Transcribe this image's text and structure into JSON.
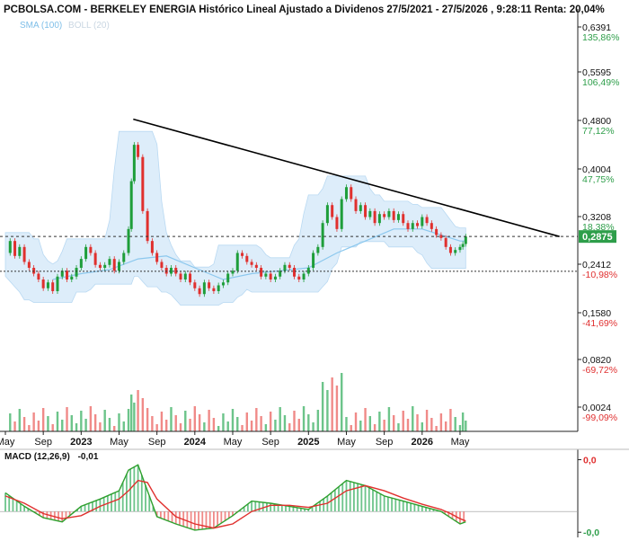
{
  "title": "PCBOLSA.COM - BERKELEY ENERGIA Histórico Lineal Ajustado a Dividenos 27/5/2021 - 27/5/2026 , 9:28:11 Renta: 20,04%",
  "indicators": {
    "sma": "SMA (100)",
    "boll": "BOLL (20)"
  },
  "colors": {
    "up": "#1e9e3a",
    "down": "#e0302e",
    "sma": "#8cc8ee",
    "boll_band": "#cfe6f8",
    "volume_up": "#6cc48a",
    "volume_down": "#f08a88",
    "trendline": "#000000",
    "current_price_box": "#2e9e4a",
    "positive_pct": "#2e9e4a",
    "negative_pct": "#e03030",
    "macd_fast": "#2ea02e",
    "macd_signal": "#e0302e"
  },
  "chart_data": [
    {
      "type": "line",
      "name": "price",
      "y_ticks": [
        {
          "price": "0,6391",
          "pct": "135,86%",
          "value": 0.6391,
          "sign": "pos"
        },
        {
          "price": "0,5595",
          "pct": "106,49%",
          "value": 0.5595,
          "sign": "pos"
        },
        {
          "price": "0,4800",
          "pct": "77,12%",
          "value": 0.48,
          "sign": "pos"
        },
        {
          "price": "0,4004",
          "pct": "47,75%",
          "value": 0.4004,
          "sign": "pos"
        },
        {
          "price": "0,3208",
          "pct": "18,38%",
          "value": 0.3208,
          "sign": "pos"
        },
        {
          "price": "0,2412",
          "pct": "-10,98%",
          "value": 0.2412,
          "sign": "neg"
        },
        {
          "price": "0,1580",
          "pct": "-41,69%",
          "value": 0.158,
          "sign": "neg"
        },
        {
          "price": "0,0820",
          "pct": "-69,72%",
          "value": 0.082,
          "sign": "neg"
        },
        {
          "price": "0,0024",
          "pct": "-99,09%",
          "value": 0.0024,
          "sign": "neg"
        }
      ],
      "ylim": [
        0.0,
        0.6391
      ],
      "current_price": {
        "label": "0,2875",
        "value": 0.2875
      },
      "reference_price": 0.229,
      "x_ticks": [
        {
          "label": "May",
          "t": 0.0,
          "bold": false
        },
        {
          "label": "Sep",
          "t": 4.0,
          "bold": false
        },
        {
          "label": "2023",
          "t": 8.0,
          "bold": true
        },
        {
          "label": "May",
          "t": 12.0,
          "bold": false
        },
        {
          "label": "Sep",
          "t": 16.0,
          "bold": false
        },
        {
          "label": "2024",
          "t": 20.0,
          "bold": true
        },
        {
          "label": "May",
          "t": 24.0,
          "bold": false
        },
        {
          "label": "Sep",
          "t": 28.0,
          "bold": false
        },
        {
          "label": "2025",
          "t": 32.0,
          "bold": true
        },
        {
          "label": "May",
          "t": 36.0,
          "bold": false
        },
        {
          "label": "Sep",
          "t": 40.0,
          "bold": false
        },
        {
          "label": "2026",
          "t": 44.0,
          "bold": true
        },
        {
          "label": "May",
          "t": 48.0,
          "bold": false
        }
      ],
      "x_range_months": [
        0.0,
        61.0
      ],
      "trendline": [
        [
          13.5,
          0.482
        ],
        [
          58.5,
          0.2875
        ]
      ],
      "price_points": [
        [
          0,
          0.26
        ],
        [
          0.5,
          0.28
        ],
        [
          1,
          0.255
        ],
        [
          1.5,
          0.27
        ],
        [
          2,
          0.245
        ],
        [
          2.5,
          0.235
        ],
        [
          3,
          0.225
        ],
        [
          3.5,
          0.215
        ],
        [
          4,
          0.2
        ],
        [
          4.5,
          0.21
        ],
        [
          5,
          0.195
        ],
        [
          5.5,
          0.22
        ],
        [
          6,
          0.23
        ],
        [
          6.5,
          0.215
        ],
        [
          7,
          0.22
        ],
        [
          7.5,
          0.235
        ],
        [
          8,
          0.25
        ],
        [
          8.5,
          0.27
        ],
        [
          9,
          0.26
        ],
        [
          9.5,
          0.24
        ],
        [
          10,
          0.235
        ],
        [
          10.5,
          0.24
        ],
        [
          11,
          0.25
        ],
        [
          11.5,
          0.23
        ],
        [
          12,
          0.245
        ],
        [
          12.5,
          0.26
        ],
        [
          13,
          0.3
        ],
        [
          13.3,
          0.38
        ],
        [
          13.6,
          0.44
        ],
        [
          14,
          0.42
        ],
        [
          14.5,
          0.33
        ],
        [
          15,
          0.28
        ],
        [
          15.5,
          0.26
        ],
        [
          16,
          0.245
        ],
        [
          16.5,
          0.235
        ],
        [
          17,
          0.225
        ],
        [
          17.5,
          0.235
        ],
        [
          18,
          0.225
        ],
        [
          18.5,
          0.215
        ],
        [
          19,
          0.225
        ],
        [
          19.5,
          0.21
        ],
        [
          20,
          0.2
        ],
        [
          20.5,
          0.19
        ],
        [
          21,
          0.21
        ],
        [
          21.5,
          0.2
        ],
        [
          22,
          0.195
        ],
        [
          22.5,
          0.205
        ],
        [
          23,
          0.21
        ],
        [
          23.5,
          0.225
        ],
        [
          24,
          0.23
        ],
        [
          24.5,
          0.26
        ],
        [
          25,
          0.255
        ],
        [
          25.5,
          0.245
        ],
        [
          26,
          0.24
        ],
        [
          26.5,
          0.235
        ],
        [
          27,
          0.22
        ],
        [
          27.5,
          0.225
        ],
        [
          28,
          0.215
        ],
        [
          28.5,
          0.22
        ],
        [
          29,
          0.23
        ],
        [
          29.5,
          0.24
        ],
        [
          30,
          0.235
        ],
        [
          30.5,
          0.22
        ],
        [
          31,
          0.215
        ],
        [
          31.5,
          0.225
        ],
        [
          32,
          0.235
        ],
        [
          32.5,
          0.26
        ],
        [
          33,
          0.27
        ],
        [
          33.5,
          0.31
        ],
        [
          34,
          0.34
        ],
        [
          34.5,
          0.32
        ],
        [
          35,
          0.3
        ],
        [
          35.5,
          0.35
        ],
        [
          36,
          0.37
        ],
        [
          36.5,
          0.35
        ],
        [
          37,
          0.33
        ],
        [
          37.5,
          0.34
        ],
        [
          38,
          0.32
        ],
        [
          38.5,
          0.33
        ],
        [
          39,
          0.31
        ],
        [
          39.5,
          0.325
        ],
        [
          40,
          0.32
        ],
        [
          40.5,
          0.33
        ],
        [
          41,
          0.315
        ],
        [
          41.5,
          0.325
        ],
        [
          42,
          0.31
        ],
        [
          42.5,
          0.3
        ],
        [
          43,
          0.31
        ],
        [
          43.5,
          0.305
        ],
        [
          44,
          0.32
        ],
        [
          44.5,
          0.31
        ],
        [
          45,
          0.3
        ],
        [
          45.5,
          0.29
        ],
        [
          46,
          0.285
        ],
        [
          46.5,
          0.27
        ],
        [
          47,
          0.26
        ],
        [
          47.5,
          0.265
        ],
        [
          48,
          0.27
        ],
        [
          48.3,
          0.275
        ],
        [
          48.6,
          0.2875
        ]
      ],
      "sma_points": [
        [
          5,
          0.215
        ],
        [
          8,
          0.225
        ],
        [
          11,
          0.232
        ],
        [
          14,
          0.25
        ],
        [
          17,
          0.255
        ],
        [
          20,
          0.235
        ],
        [
          23,
          0.215
        ],
        [
          26,
          0.225
        ],
        [
          29,
          0.23
        ],
        [
          32,
          0.235
        ],
        [
          35,
          0.26
        ],
        [
          38,
          0.28
        ],
        [
          41,
          0.3
        ],
        [
          44,
          0.3
        ],
        [
          46,
          0.29
        ],
        [
          48,
          0.28
        ],
        [
          48.6,
          0.28
        ]
      ]
    },
    {
      "type": "bar",
      "name": "MACD (12,26,9)",
      "value_label": "-0,01",
      "y_ticks": [
        {
          "label": "0,0",
          "value": 0.05,
          "sign": "pos"
        },
        {
          "label": "-0,0",
          "value": -0.02,
          "sign": "neg"
        }
      ],
      "ylim": [
        -0.025,
        0.06
      ],
      "macd_line": [
        [
          0,
          0.018
        ],
        [
          2,
          0.005
        ],
        [
          4,
          -0.006
        ],
        [
          6,
          -0.01
        ],
        [
          8,
          0.005
        ],
        [
          10,
          0.012
        ],
        [
          12,
          0.02
        ],
        [
          13,
          0.04
        ],
        [
          14,
          0.045
        ],
        [
          15,
          0.02
        ],
        [
          16,
          -0.005
        ],
        [
          18,
          -0.012
        ],
        [
          20,
          -0.018
        ],
        [
          22,
          -0.016
        ],
        [
          24,
          -0.004
        ],
        [
          26,
          0.01
        ],
        [
          28,
          0.008
        ],
        [
          30,
          0.005
        ],
        [
          32,
          0.002
        ],
        [
          34,
          0.015
        ],
        [
          36,
          0.03
        ],
        [
          38,
          0.025
        ],
        [
          40,
          0.015
        ],
        [
          42,
          0.01
        ],
        [
          44,
          0.005
        ],
        [
          46,
          0.0
        ],
        [
          47,
          -0.006
        ],
        [
          48,
          -0.012
        ],
        [
          48.6,
          -0.01
        ]
      ],
      "signal_line": [
        [
          0,
          0.015
        ],
        [
          2,
          0.008
        ],
        [
          4,
          -0.002
        ],
        [
          6,
          -0.007
        ],
        [
          8,
          -0.004
        ],
        [
          10,
          0.005
        ],
        [
          12,
          0.012
        ],
        [
          13,
          0.02
        ],
        [
          14,
          0.03
        ],
        [
          15,
          0.028
        ],
        [
          16,
          0.012
        ],
        [
          18,
          -0.005
        ],
        [
          20,
          -0.012
        ],
        [
          22,
          -0.016
        ],
        [
          24,
          -0.012
        ],
        [
          26,
          0.0
        ],
        [
          28,
          0.006
        ],
        [
          30,
          0.006
        ],
        [
          32,
          0.004
        ],
        [
          34,
          0.008
        ],
        [
          36,
          0.02
        ],
        [
          38,
          0.025
        ],
        [
          40,
          0.02
        ],
        [
          42,
          0.013
        ],
        [
          44,
          0.007
        ],
        [
          46,
          0.002
        ],
        [
          47,
          -0.002
        ],
        [
          48,
          -0.007
        ],
        [
          48.6,
          -0.009
        ]
      ]
    }
  ]
}
